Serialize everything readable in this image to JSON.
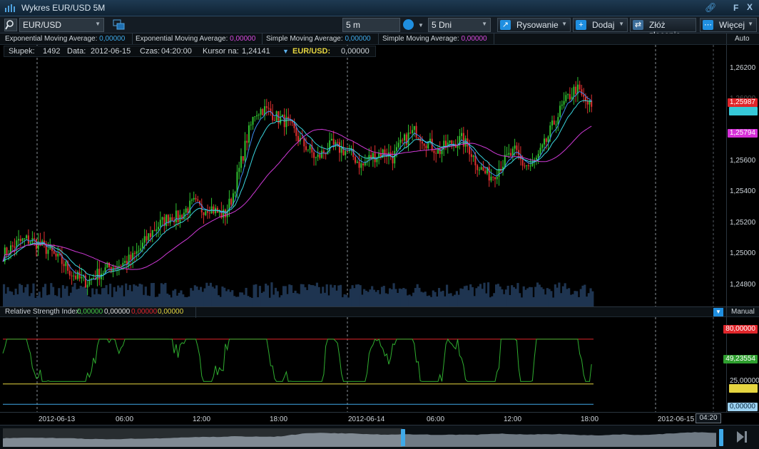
{
  "window": {
    "title": "Wykres EUR/USD 5M",
    "f_label": "F",
    "close_label": "X"
  },
  "toolbar": {
    "symbol": "EUR/USD",
    "interval": "5 m",
    "range": "5 Dni",
    "drawing_label": "Rysowanie",
    "add_label": "Dodaj",
    "order_label": "Złóż zlecenie",
    "more_label": "Więcej"
  },
  "indicators": [
    {
      "name": "Exponential Moving Average:",
      "value": "0,00000",
      "color": "#3fa9e8"
    },
    {
      "name": "Exponential Moving Average:",
      "value": "0,00000",
      "color": "#d94be0"
    },
    {
      "name": "Simple Moving Average:",
      "value": "0,00000",
      "color": "#3fa9e8"
    },
    {
      "name": "Simple Moving Average:",
      "value": "0,00000",
      "color": "#d94be0"
    }
  ],
  "scale_mode": "Auto",
  "info": {
    "bar_label": "Słupek:",
    "bar_value": "1492",
    "date_label": "Data:",
    "date_value": "2012-06-15",
    "time_label": "Czas:",
    "time_value": "04:20:00",
    "cursor_label": "Kursor na:",
    "cursor_value": "1,24141",
    "pair_label": "EUR/USD:",
    "pair_value": "0,00000"
  },
  "price_axis": {
    "ticks": [
      "1,26200",
      "1,26000",
      "1,25800",
      "1,25600",
      "1,25400",
      "1,25200",
      "1,25000",
      "1,24800"
    ],
    "tags": [
      {
        "label": "1,25987",
        "color": "#e0262b"
      },
      {
        "label": "1,25794",
        "color": "#d630d8"
      }
    ]
  },
  "rsi": {
    "header": "Relative Strength Index:",
    "values": [
      {
        "text": "0,00000",
        "color": "#45c845"
      },
      {
        "text": "0,00000",
        "color": "#e0e0e0"
      },
      {
        "text": "0,00000",
        "color": "#e0262b"
      },
      {
        "text": "0,00000",
        "color": "#e5d540"
      }
    ],
    "mode": "Manual",
    "levels": [
      {
        "label": "80,00000",
        "value": 80,
        "color": "#e0262b"
      },
      {
        "label": "25,00000",
        "value": 25,
        "color": "#e5d540"
      },
      {
        "label": "0,00000",
        "value": 0,
        "color": "#3fa9e8"
      }
    ],
    "current": {
      "label": "49,23554",
      "color": "#2f9f2f"
    },
    "axis_ticks": [
      "25,00000"
    ]
  },
  "time_axis": {
    "labels": [
      "2012-06-13",
      "06:00",
      "12:00",
      "18:00",
      "2012-06-14",
      "06:00",
      "12:00",
      "18:00",
      "2012-06-15"
    ],
    "cursor_time": "04:20"
  },
  "colors": {
    "bull": "#2fc02f",
    "bear": "#e03030",
    "ema_fast": "#3e8cf0",
    "ema_slow": "#3ad6e0",
    "sma_slow": "#d03ad8",
    "rsi": "#2fae2f",
    "volume": "#1e3450"
  },
  "chart_data": {
    "type": "line",
    "title": "",
    "series": [
      {
        "values": [
          1.2502,
          1.2506,
          1.251,
          1.2512,
          1.2511,
          1.2508,
          1.2505,
          1.25,
          1.2496,
          1.249,
          1.2486,
          1.2484,
          1.2488,
          1.2491,
          1.2494,
          1.2495,
          1.2497,
          1.25,
          1.2506,
          1.2514,
          1.252,
          1.2524,
          1.2528,
          1.2526,
          1.2532,
          1.2536,
          1.2532,
          1.2534,
          1.253,
          1.2528,
          1.254,
          1.256,
          1.258,
          1.2596,
          1.2598,
          1.2596,
          1.2592,
          1.259,
          1.2584,
          1.2576,
          1.2572,
          1.2565,
          1.257,
          1.2574,
          1.2572,
          1.257,
          1.2566,
          1.256,
          1.2566,
          1.2568,
          1.257,
          1.2566,
          1.2574,
          1.258,
          1.2584,
          1.2578,
          1.2574,
          1.257,
          1.2574,
          1.2576,
          1.2578,
          1.2572,
          1.2562,
          1.2556,
          1.2554,
          1.256,
          1.2566,
          1.257,
          1.2562,
          1.256,
          1.2566,
          1.2576,
          1.2588,
          1.2598,
          1.2606,
          1.2612,
          1.2604,
          1.2599
        ]
      }
    ]
  }
}
